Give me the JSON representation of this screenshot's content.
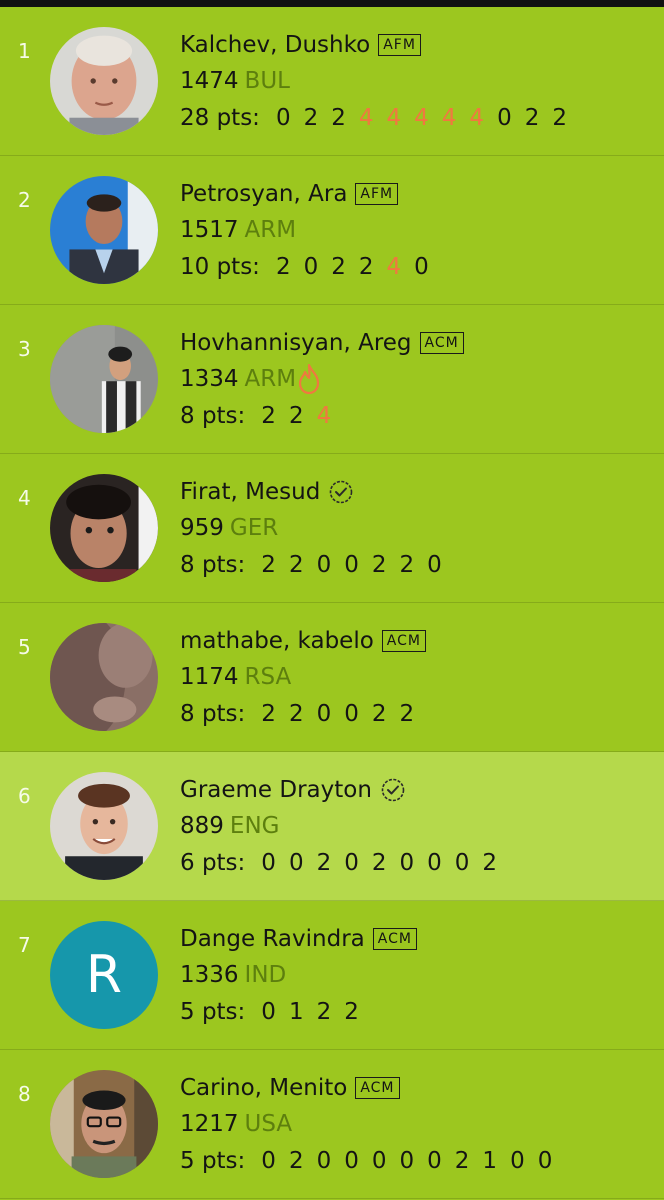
{
  "players": [
    {
      "rank": "1",
      "name": "Kalchev, Dushko",
      "title": "AFM",
      "verified": false,
      "rating": "1474",
      "country": "BUL",
      "fire": false,
      "pts": "28 pts:",
      "scores": [
        "0",
        "2",
        "2",
        "4",
        "4",
        "4",
        "4",
        "4",
        "0",
        "2",
        "2"
      ],
      "highlight_scores": [
        3,
        4,
        5,
        6,
        7
      ],
      "avatar": "photo-bald-man"
    },
    {
      "rank": "2",
      "name": "Petrosyan, Ara",
      "title": "AFM",
      "verified": false,
      "rating": "1517",
      "country": "ARM",
      "fire": false,
      "pts": "10 pts:",
      "scores": [
        "2",
        "0",
        "2",
        "2",
        "4",
        "0"
      ],
      "highlight_scores": [
        4
      ],
      "avatar": "photo-man-suit"
    },
    {
      "rank": "3",
      "name": "Hovhannisyan, Areg",
      "title": "ACM",
      "verified": false,
      "rating": "1334",
      "country": "ARM",
      "fire": true,
      "pts": "8 pts:",
      "scores": [
        "2",
        "2",
        "4"
      ],
      "highlight_scores": [
        2
      ],
      "avatar": "photo-young-man"
    },
    {
      "rank": "4",
      "name": "Firat, Mesud",
      "title": "",
      "verified": true,
      "rating": "959",
      "country": "GER",
      "fire": false,
      "pts": "8 pts:",
      "scores": [
        "2",
        "2",
        "0",
        "0",
        "2",
        "2",
        "0"
      ],
      "highlight_scores": [],
      "avatar": "photo-dark-hair"
    },
    {
      "rank": "5",
      "name": "mathabe, kabelo",
      "title": "ACM",
      "verified": false,
      "rating": "1174",
      "country": "RSA",
      "fire": false,
      "pts": "8 pts:",
      "scores": [
        "2",
        "2",
        "0",
        "0",
        "2",
        "2"
      ],
      "highlight_scores": [],
      "avatar": "photo-blurry"
    },
    {
      "rank": "6",
      "name": "Graeme Drayton",
      "title": "",
      "verified": true,
      "rating": "889",
      "country": "ENG",
      "fire": false,
      "pts": "6 pts:",
      "scores": [
        "0",
        "0",
        "2",
        "0",
        "2",
        "0",
        "0",
        "0",
        "2"
      ],
      "highlight_scores": [],
      "avatar": "photo-smiling-man",
      "highlight": true
    },
    {
      "rank": "7",
      "name": "Dange Ravindra",
      "title": "ACM",
      "verified": false,
      "rating": "1336",
      "country": "IND",
      "fire": false,
      "pts": "5 pts:",
      "scores": [
        "0",
        "1",
        "2",
        "2"
      ],
      "highlight_scores": [],
      "avatar": "letter",
      "avatar_letter": "R"
    },
    {
      "rank": "8",
      "name": "Carino, Menito",
      "title": "ACM",
      "verified": false,
      "rating": "1217",
      "country": "USA",
      "fire": false,
      "pts": "5 pts:",
      "scores": [
        "0",
        "2",
        "0",
        "0",
        "0",
        "0",
        "0",
        "2",
        "1",
        "0",
        "0"
      ],
      "highlight_scores": [],
      "avatar": "photo-glasses-man"
    }
  ],
  "colors": {
    "background": "#9cc71f",
    "highlight_row": "#b5d94b",
    "country": "#5d7f0e",
    "score_highlight": "#f07840",
    "rank": "#f6fbe8",
    "avatar_letter_bg": "#1697ab"
  },
  "icons": {
    "verified": "verified-check-icon",
    "fire": "fire-icon"
  }
}
